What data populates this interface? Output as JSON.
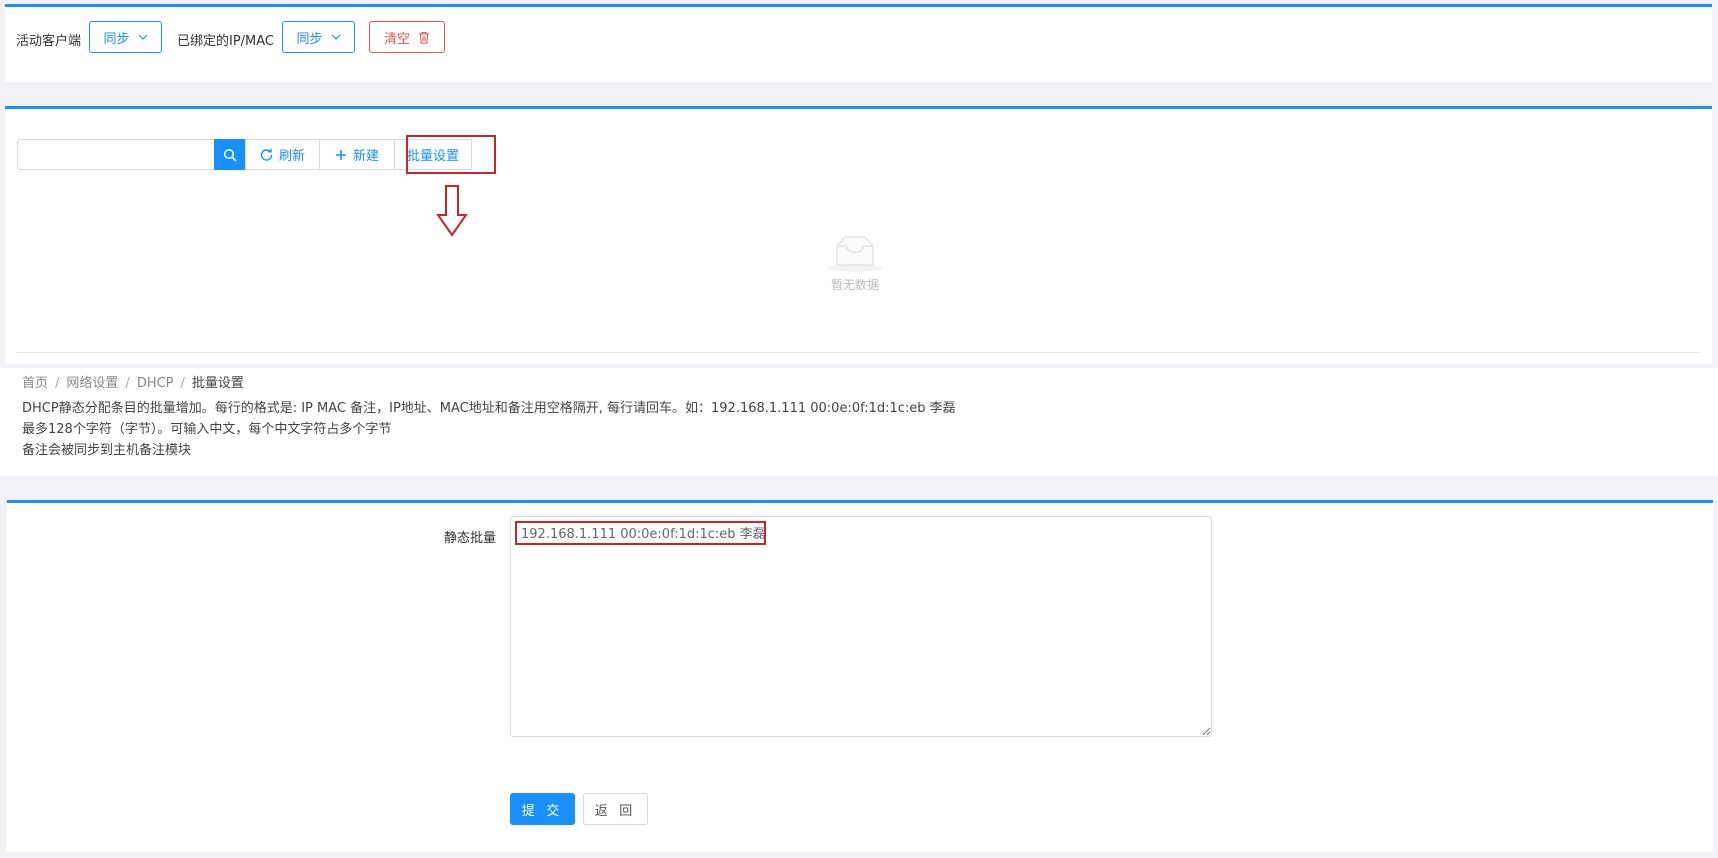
{
  "top_bar": {
    "active_clients_label": "活动客户端",
    "sync_label_1": "同步",
    "bound_ip_mac_label": "已绑定的IP/MAC",
    "sync_label_2": "同步",
    "clear_label": "清空"
  },
  "toolbar": {
    "search_value": "",
    "refresh_label": "刷新",
    "new_label": "新建",
    "batch_label": "批量设置"
  },
  "empty": {
    "text": "暂无数据"
  },
  "breadcrumb": {
    "home": "首页",
    "network": "网络设置",
    "dhcp": "DHCP",
    "current": "批量设置"
  },
  "description": {
    "line1": "DHCP静态分配条目的批量增加。每行的格式是: IP MAC 备注，IP地址、MAC地址和备注用空格隔开, 每行请回车。如：192.168.1.111 00:0e:0f:1d:1c:eb 李磊",
    "line2": "最多128个字符（字节）。可输入中文，每个中文字符占多个字节",
    "line3": "备注会被同步到主机备注模块"
  },
  "form": {
    "label": "静态批量",
    "textarea_value": "192.168.1.111 00:0e:0f:1d:1c:eb 李磊",
    "submit_label": "提 交",
    "back_label": "返 回"
  },
  "colors": {
    "primary": "#1890ff",
    "danger": "#e55353",
    "highlight_red": "#c9252c"
  }
}
